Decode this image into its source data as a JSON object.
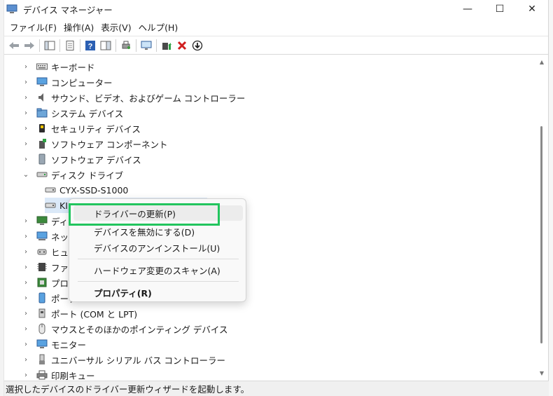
{
  "window": {
    "title": "デバイス マネージャー",
    "controls": {
      "minimize": "—",
      "maximize": "☐",
      "close": "✕"
    }
  },
  "menubar": [
    {
      "label": "ファイル(F)"
    },
    {
      "label": "操作(A)"
    },
    {
      "label": "表示(V)"
    },
    {
      "label": "ヘルプ(H)"
    }
  ],
  "tree": [
    {
      "label": "キーボード",
      "expand": "›",
      "icon": "keyboard-icon"
    },
    {
      "label": "コンピューター",
      "expand": "›",
      "icon": "computer-icon"
    },
    {
      "label": "サウンド、ビデオ、およびゲーム コントローラー",
      "expand": "›",
      "icon": "speaker-icon"
    },
    {
      "label": "システム デバイス",
      "expand": "›",
      "icon": "system-folder-icon"
    },
    {
      "label": "セキュリティ デバイス",
      "expand": "›",
      "icon": "security-key-icon"
    },
    {
      "label": "ソフトウェア コンポーネント",
      "expand": "›",
      "icon": "software-component-icon"
    },
    {
      "label": "ソフトウェア デバイス",
      "expand": "›",
      "icon": "software-device-icon"
    },
    {
      "label": "ディスク ドライブ",
      "expand": "⌄",
      "icon": "disk-drive-icon"
    },
    {
      "label": "CYX-SSD-S1000",
      "expand": "",
      "icon": "drive-icon"
    },
    {
      "label": "KI",
      "expand": "",
      "icon": "drive-icon",
      "selected": true
    },
    {
      "label": "ディス",
      "expand": "›",
      "icon": "display-adapter-icon"
    },
    {
      "label": "ネット",
      "expand": "›",
      "icon": "network-adapter-icon"
    },
    {
      "label": "ヒュー",
      "expand": "›",
      "icon": "hid-icon"
    },
    {
      "label": "ファー",
      "expand": "›",
      "icon": "firmware-icon"
    },
    {
      "label": "プロセ",
      "expand": "›",
      "icon": "processor-icon"
    },
    {
      "label": "ポータ",
      "expand": "›",
      "icon": "portable-device-icon"
    },
    {
      "label": "ポート (COM と LPT)",
      "expand": "›",
      "icon": "port-icon"
    },
    {
      "label": "マウスとそのほかのポインティング デバイス",
      "expand": "›",
      "icon": "mouse-icon"
    },
    {
      "label": "モニター",
      "expand": "›",
      "icon": "monitor-icon"
    },
    {
      "label": "ユニバーサル シリアル バス コントローラー",
      "expand": "›",
      "icon": "usb-icon"
    },
    {
      "label": "印刷キュー",
      "expand": "›",
      "icon": "printer-icon"
    }
  ],
  "context_menu": {
    "items": [
      {
        "label": "ドライバーの更新(P)"
      },
      {
        "label": "デバイスを無効にする(D)"
      },
      {
        "label": "デバイスのアンインストール(U)"
      },
      {
        "label": "ハードウェア変更のスキャン(A)"
      },
      {
        "label": "プロパティ(R)"
      }
    ]
  },
  "statusbar": {
    "text": "選択したデバイスのドライバー更新ウィザードを起動します。"
  },
  "colors": {
    "highlight": "#22c55e",
    "selection": "#dbe9f8"
  }
}
